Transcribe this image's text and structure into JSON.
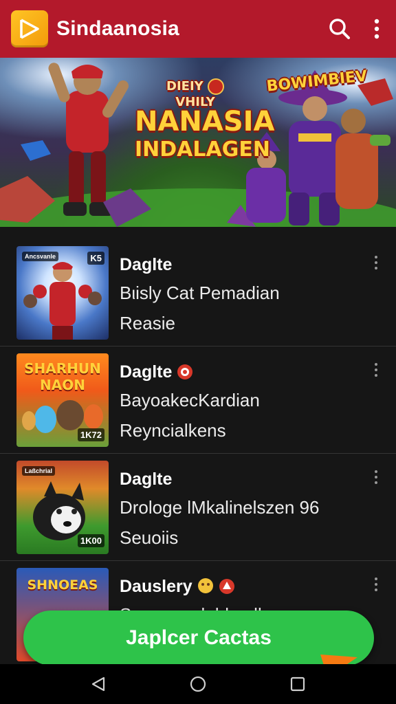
{
  "app": {
    "title": "Sindaanosia",
    "accent": "#b3192b",
    "logo_icon": "play-arrow-icon",
    "actions": [
      "search-icon",
      "more-vert-icon"
    ]
  },
  "banner": {
    "badge_left": "DIEIY",
    "badge_right": "VHILY",
    "title_line1": "NANASIA",
    "title_line2": "INDALAGEN",
    "right_title": "BOWIMBIEV"
  },
  "items": [
    {
      "title": "Daglte",
      "subtitle": "Bιisly Cat Pemadian",
      "meta": "Reasie",
      "thumb_tag_left": "Ancsvanle",
      "thumb_tag_right": "K5"
    },
    {
      "title": "Daglte",
      "subtitle": "BayoakecKardian",
      "meta": "Reyncialkens",
      "thumb_title_line1": "SHARHUN",
      "thumb_title_line2": "NAON",
      "thumb_tag_right": "1K72"
    },
    {
      "title": "Daglte",
      "subtitle": "Drologe lMkalinelszen 96",
      "meta": "Seuoiis",
      "thumb_tag_left": "Laßchrial",
      "thumb_tag_right": "1K00"
    },
    {
      "title": "Dauslery",
      "subtitle": "Sa aaaaa lnhlaa llaa a",
      "meta": "",
      "thumb_title_line1": "SHNOEAS"
    }
  ],
  "cta": {
    "label": "Japlcer Cactas",
    "color": "#2ec34a"
  },
  "navbar": {
    "buttons": [
      "back-icon",
      "home-icon",
      "recents-icon"
    ]
  }
}
